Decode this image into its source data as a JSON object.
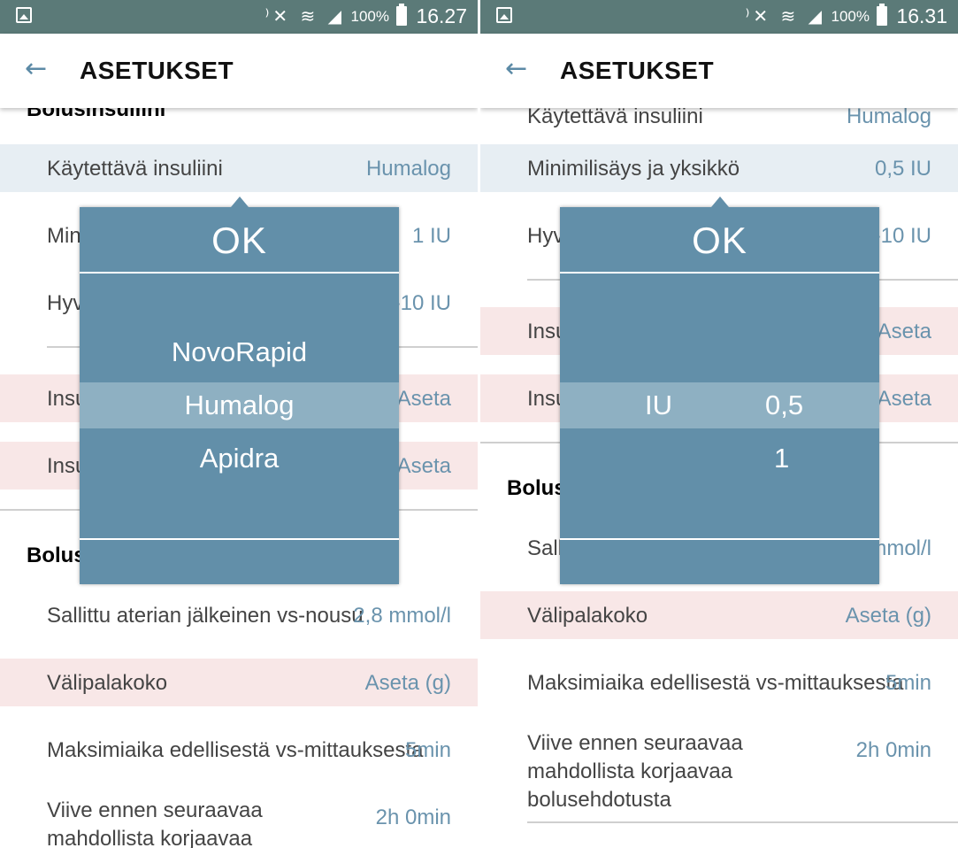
{
  "status_left": {
    "battery": "100%",
    "time": "16.27"
  },
  "status_right": {
    "battery": "100%",
    "time": "16.31"
  },
  "appbar": {
    "title": "ASETUKSET"
  },
  "left": {
    "cut_header": "Bolusinsuliini",
    "rows": [
      {
        "label": "Käytettävä insuliini",
        "value": "Humalog"
      },
      {
        "label": "Min",
        "value": "1 IU"
      },
      {
        "label": "Hyv",
        "value": "-10 IU"
      },
      {
        "label": "Insu",
        "value": "Aseta"
      },
      {
        "label": "Insu",
        "value": "Aseta"
      }
    ],
    "section": "Bolusl",
    "rows2": [
      {
        "label": "Sallittu aterian jälkeinen vs-nousu",
        "value": "2,8 mmol/l"
      },
      {
        "label": "Välipalakoko",
        "value": "Aseta (g)"
      },
      {
        "label": "Maksimiaika edellisestä vs-mittauksesta",
        "value": "5min"
      },
      {
        "label": "Viive ennen seuraavaa mahdollista korjaavaa bolusehdotusta",
        "value": "2h 0min"
      }
    ],
    "picker": {
      "ok": "OK",
      "options": [
        "NovoRapid",
        "Humalog",
        "Apidra"
      ],
      "selected": "Humalog"
    }
  },
  "right": {
    "cut_row": {
      "label": "Käytettävä insuliini",
      "value": "Humalog"
    },
    "rows": [
      {
        "label": "Minimilisäys ja yksikkö",
        "value": "0,5 IU"
      },
      {
        "label": "Hyv",
        "value": "-10 IU"
      },
      {
        "label": "Insu",
        "value": "Aseta"
      },
      {
        "label": "Insu",
        "value": "Aseta"
      }
    ],
    "section": "Bolusl",
    "rows2": [
      {
        "label": "Sall",
        "value": "mmol/l"
      },
      {
        "label": "Välipalakoko",
        "value": "Aseta (g)"
      },
      {
        "label": "Maksimiaika edellisestä vs-mittauksesta",
        "value": "5min"
      },
      {
        "label": "Viive ennen seuraavaa mahdollista korjaavaa bolusehdotusta",
        "value": "2h 0min"
      }
    ],
    "picker": {
      "ok": "OK",
      "unit": "IU",
      "values": [
        "0,5",
        "1"
      ],
      "selected": "0,5"
    }
  },
  "colors": {
    "statusbar": "#5b7a78",
    "picker": "#628fa9",
    "picker_selected": "#8eb0c2",
    "value_text": "#6a93ad",
    "highlight_pink": "#f8e7e7",
    "highlight_blue": "#e7eef3"
  }
}
